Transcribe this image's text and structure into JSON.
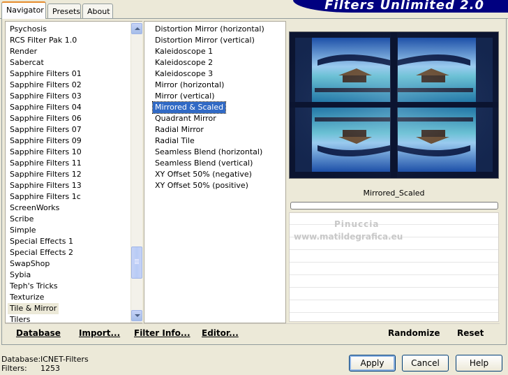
{
  "tabs": [
    {
      "label": "Navigator",
      "active": true
    },
    {
      "label": "Presets",
      "active": false
    },
    {
      "label": "About",
      "active": false
    }
  ],
  "banner": "Filters Unlimited 2.0",
  "categories": {
    "items": [
      "Psychosis",
      "RCS Filter Pak 1.0",
      "Render",
      "Sabercat",
      "Sapphire Filters 01",
      "Sapphire Filters 02",
      "Sapphire Filters 03",
      "Sapphire Filters 04",
      "Sapphire Filters 06",
      "Sapphire Filters 07",
      "Sapphire Filters 09",
      "Sapphire Filters 10",
      "Sapphire Filters 11",
      "Sapphire Filters 12",
      "Sapphire Filters 13",
      "Sapphire Filters 1c",
      "ScreenWorks",
      "Scribe",
      "Simple",
      "Special Effects 1",
      "Special Effects 2",
      "SwapShop",
      "Sybia",
      "Teph's Tricks",
      "Texturize",
      "Tile & Mirror",
      "Tilers"
    ],
    "current": "Tile & Mirror"
  },
  "filters": {
    "items": [
      "Distortion Mirror (horizontal)",
      "Distortion Mirror (vertical)",
      "Kaleidoscope 1",
      "Kaleidoscope 2",
      "Kaleidoscope 3",
      "Mirror (horizontal)",
      "Mirror (vertical)",
      "Mirrored & Scaled",
      "Quadrant Mirror",
      "Radial Mirror",
      "Radial Tile",
      "Seamless Blend (horizontal)",
      "Seamless Blend (vertical)",
      "XY Offset 50% (negative)",
      "XY Offset 50% (positive)"
    ],
    "selected": "Mirrored & Scaled"
  },
  "preview": {
    "filter_name": "Mirrored_Scaled",
    "watermark_line1": "Pinuccia",
    "watermark_line2": "www.matildegrafica.eu"
  },
  "toolbar": {
    "database": "Database",
    "import": "Import...",
    "filter_info": "Filter Info...",
    "editor": "Editor...",
    "randomize": "Randomize",
    "reset": "Reset"
  },
  "status": {
    "database_label": "Database:",
    "database_value": "ICNET-Filters",
    "filters_label": "Filters:",
    "filters_value": "1253"
  },
  "buttons": {
    "apply": "Apply",
    "cancel": "Cancel",
    "help": "Help"
  },
  "colors": {
    "selection": "#316ac5",
    "banner": "#000080",
    "tab_accent": "#e68b2c"
  }
}
